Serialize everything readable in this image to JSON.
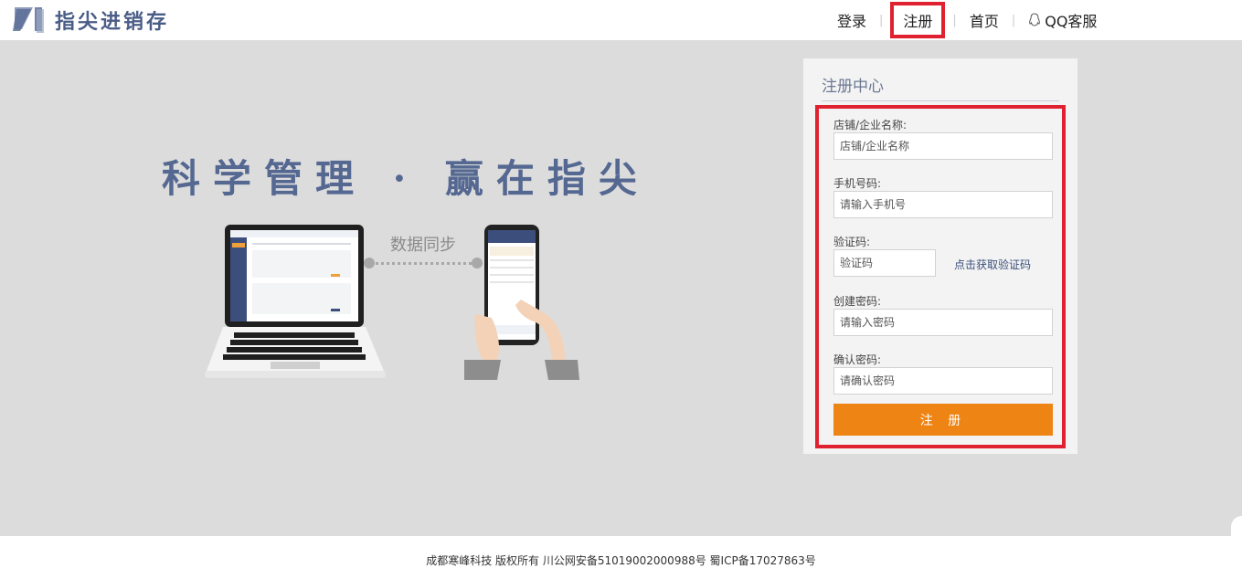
{
  "header": {
    "logo_text": "指尖进销存",
    "nav": {
      "login": "登录",
      "register": "注册",
      "home": "首页",
      "qq_service": "QQ客服",
      "separator": "|"
    }
  },
  "hero": {
    "slogan": "科学管理 · 赢在指尖",
    "sync_label": "数据同步"
  },
  "register_panel": {
    "title": "注册中心",
    "fields": {
      "store_name": {
        "label": "店铺/企业名称:",
        "placeholder": "店铺/企业名称"
      },
      "phone": {
        "label": "手机号码:",
        "placeholder": "请输入手机号"
      },
      "code": {
        "label": "验证码:",
        "placeholder": "验证码"
      },
      "password": {
        "label": "创建密码:",
        "placeholder": "请输入密码"
      },
      "confirm": {
        "label": "确认密码:",
        "placeholder": "请确认密码"
      }
    },
    "get_code_link": "点击获取验证码",
    "submit_label": "注 册"
  },
  "footer": {
    "text": "成都寒峰科技 版权所有  川公网安备51019002000988号 蜀ICP备17027863号"
  },
  "colors": {
    "brand": "#4a5d87",
    "accent": "#ee8414",
    "highlight": "#e0212f",
    "background": "#dcdcdc"
  }
}
